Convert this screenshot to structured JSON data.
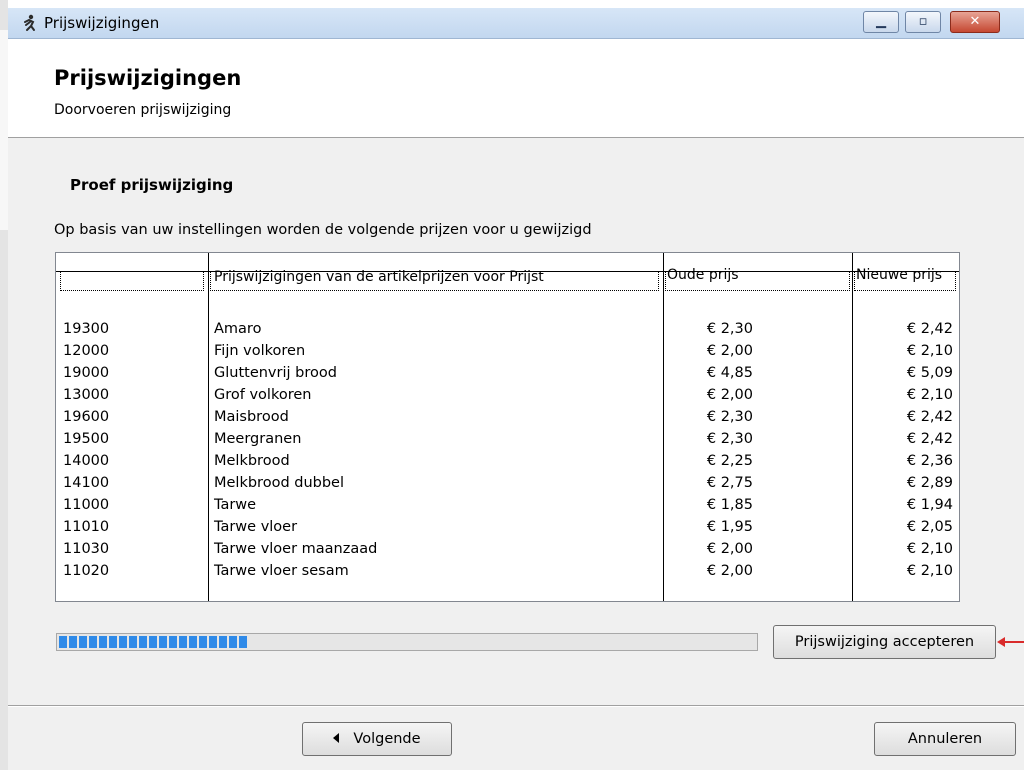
{
  "window": {
    "title": "Prijswijzigingen"
  },
  "header": {
    "title": "Prijswijzigingen",
    "subtitle": "Doorvoeren prijswijziging"
  },
  "section_title": "Proef prijswijziging",
  "description": "Op basis van uw instellingen worden de volgende prijzen voor u gewijzigd",
  "grid": {
    "columns": [
      "",
      "",
      "Oude prijs",
      "Nieuwe prijs"
    ],
    "subheader": "Prijswijzigingen van de artikelprijzen voor Prijst",
    "rows": [
      {
        "code": "19300",
        "name": "Amaro",
        "old": "€ 2,30",
        "new": "€ 2,42"
      },
      {
        "code": "12000",
        "name": "Fijn volkoren",
        "old": "€ 2,00",
        "new": "€ 2,10"
      },
      {
        "code": "19000",
        "name": "Gluttenvrij brood",
        "old": "€ 4,85",
        "new": "€ 5,09"
      },
      {
        "code": "13000",
        "name": "Grof volkoren",
        "old": "€ 2,00",
        "new": "€ 2,10"
      },
      {
        "code": "19600",
        "name": "Maisbrood",
        "old": "€ 2,30",
        "new": "€ 2,42"
      },
      {
        "code": "19500",
        "name": "Meergranen",
        "old": "€ 2,30",
        "new": "€ 2,42"
      },
      {
        "code": "14000",
        "name": "Melkbrood",
        "old": "€ 2,25",
        "new": "€ 2,36"
      },
      {
        "code": "14100",
        "name": "Melkbrood dubbel",
        "old": "€ 2,75",
        "new": "€ 2,89"
      },
      {
        "code": "11000",
        "name": "Tarwe",
        "old": "€ 1,85",
        "new": "€ 1,94"
      },
      {
        "code": "11010",
        "name": "Tarwe vloer",
        "old": "€ 1,95",
        "new": "€ 2,05"
      },
      {
        "code": "11030",
        "name": "Tarwe vloer maanzaad",
        "old": "€ 2,00",
        "new": "€ 2,10"
      },
      {
        "code": "11020",
        "name": "Tarwe vloer sesam",
        "old": "€ 2,00",
        "new": "€ 2,10"
      }
    ]
  },
  "progress": {
    "fraction": 0.27,
    "color": "#2f8ae8"
  },
  "buttons": {
    "accept": "Prijswijziging accepteren",
    "next": "Volgende",
    "cancel": "Annuleren"
  },
  "icons": {
    "app": "runner-icon",
    "minimize": "minimize-icon",
    "maximize": "maximize-icon",
    "close": "close-icon",
    "arrow": "red-arrow-icon",
    "back": "triangle-left-icon"
  }
}
